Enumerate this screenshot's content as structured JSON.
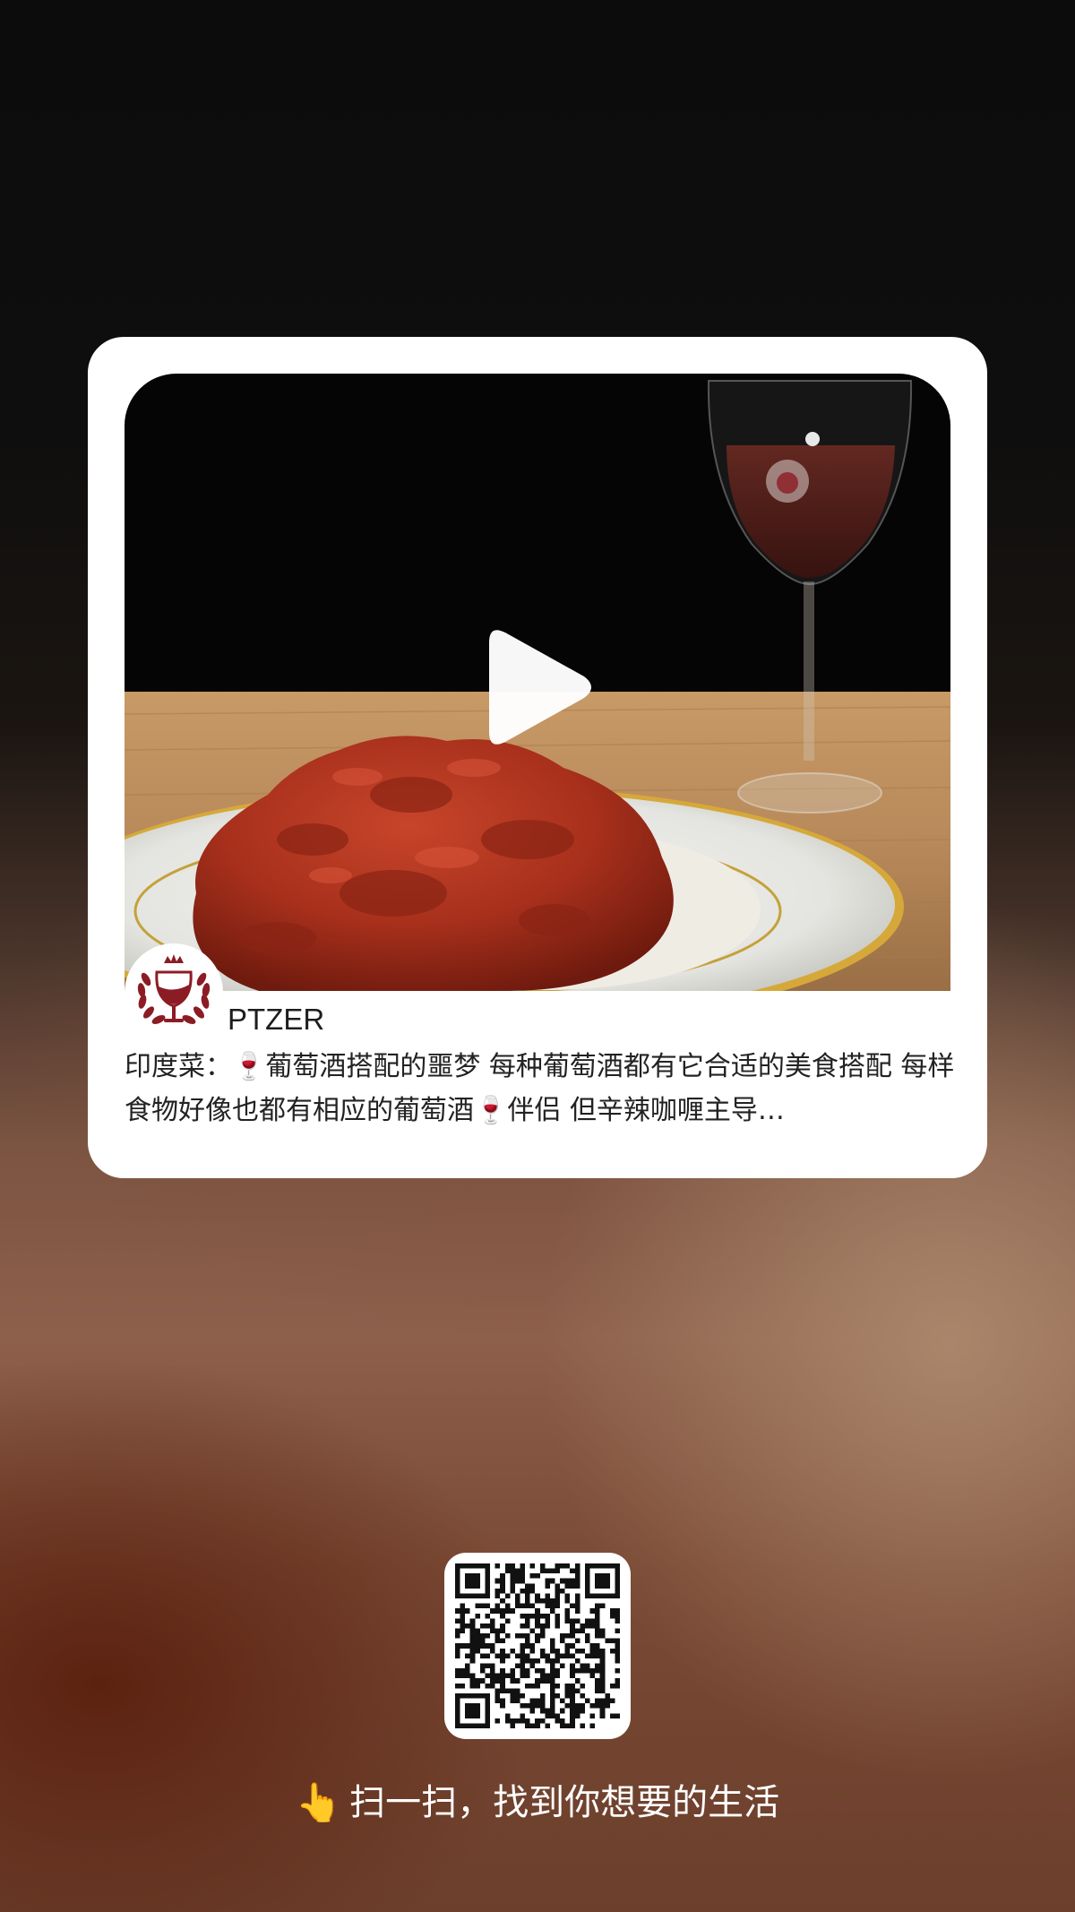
{
  "card": {
    "video": {
      "thumbnail_description_icon": "indian-curry-with-rice-and-red-wine-glass",
      "play_icon": "play-icon"
    },
    "author": {
      "name": "PTZER",
      "avatar_icon": "wine-glass-laurel-logo"
    },
    "description": "印度菜：🍷葡萄酒搭配的噩梦 每种葡萄酒都有它合适的美食搭配 每样食物好像也都有相应的葡萄酒🍷伴侣 但辛辣咖喱主导…"
  },
  "footer": {
    "qr_icon": "qr-code",
    "pointer_icon": "👆",
    "scan_text": "扫一扫，找到你想要的生活"
  },
  "colors": {
    "card_background": "#ffffff",
    "text_primary": "#222222",
    "footer_text": "#ffffff",
    "wine_red": "#8c1c24"
  }
}
